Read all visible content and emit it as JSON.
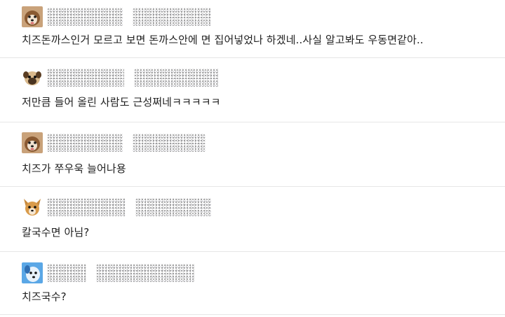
{
  "comments": [
    {
      "avatar": "brown-dog-avatar-icon",
      "text": "치즈돈까스인거 모르고 보면 돈까스안에 면 집어넣었나 하겠네..사실 알고봐도 우동면같아.."
    },
    {
      "avatar": "pug-dog-avatar-icon",
      "text": "저만큼 들어 올린 사람도 근성쩌네ㅋㅋㅋㅋㅋ"
    },
    {
      "avatar": "brown-dog-avatar-icon",
      "text": "치즈가 쭈우욱 늘어나용"
    },
    {
      "avatar": "fox-dog-avatar-icon",
      "text": "칼국수면 아님?"
    },
    {
      "avatar": "blue-dog-avatar-icon",
      "text": "치즈국수?"
    }
  ],
  "colors": {
    "divider": "#e6e6e6",
    "text": "#1f1f1f",
    "background": "#ffffff"
  }
}
